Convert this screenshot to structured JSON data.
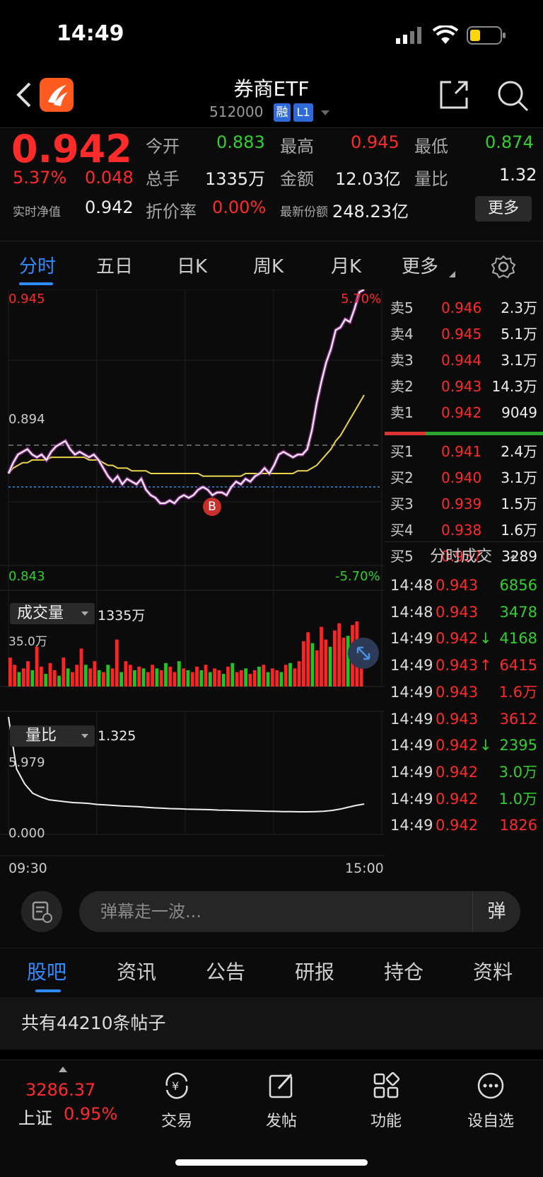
{
  "status_bar": {
    "time": "14:49"
  },
  "header": {
    "title": "券商ETF",
    "code": "512000",
    "badge_rong": "融",
    "badge_level": "L1"
  },
  "quote": {
    "price": "0.942",
    "change_pct": "5.37%",
    "change": "0.048",
    "nav_label": "实时净值",
    "nav_value": "0.942",
    "open_label": "今开",
    "open": "0.883",
    "high_label": "最高",
    "high": "0.945",
    "low_label": "最低",
    "low": "0.874",
    "volume_label": "总手",
    "volume": "1335万",
    "amount_label": "金额",
    "amount": "12.03亿",
    "ratio_label": "量比",
    "ratio": "1.32",
    "discount_label": "折价率",
    "discount": "0.00%",
    "shares_label": "最新份额",
    "shares": "248.23亿",
    "more_label": "更多"
  },
  "chart_tabs": [
    "分时",
    "五日",
    "日K",
    "周K",
    "月K",
    "更多"
  ],
  "chart_data": [
    {
      "type": "line",
      "title": "",
      "x_start": "09:30",
      "x_end": "15:00",
      "y_top_label": "0.945",
      "y_mid_label": "0.894",
      "y_bottom_label": "0.843",
      "pct_top_label": "5.70%",
      "pct_bottom_label": "-5.70%",
      "ylim": [
        0.843,
        0.945
      ],
      "buy_marker": "B",
      "series": [
        {
          "values": [
            0.877,
            0.881,
            0.884,
            0.885,
            0.886,
            0.884,
            0.883,
            0.884,
            0.882,
            0.885,
            0.887,
            0.888,
            0.889,
            0.886,
            0.884,
            0.885,
            0.884,
            0.883,
            0.884,
            0.882,
            0.879,
            0.876,
            0.874,
            0.876,
            0.873,
            0.875,
            0.874,
            0.873,
            0.875,
            0.871,
            0.869,
            0.868,
            0.866,
            0.866,
            0.867,
            0.866,
            0.868,
            0.869,
            0.868,
            0.869,
            0.871,
            0.872,
            0.871,
            0.869,
            0.87,
            0.87,
            0.869,
            0.872,
            0.874,
            0.873,
            0.875,
            0.874,
            0.876,
            0.877,
            0.879,
            0.877,
            0.88,
            0.884,
            0.885,
            0.884,
            0.883,
            0.884,
            0.884,
            0.886,
            0.893,
            0.903,
            0.911,
            0.918,
            0.923,
            0.93,
            0.931,
            0.934,
            0.933,
            0.938,
            0.944,
            0.945
          ]
        },
        {
          "values": [
            0.877,
            0.879,
            0.88,
            0.881,
            0.881,
            0.882,
            0.882,
            0.882,
            0.882,
            0.883,
            0.883,
            0.883,
            0.883,
            0.883,
            0.883,
            0.883,
            0.883,
            0.882,
            0.882,
            0.882,
            0.881,
            0.88,
            0.88,
            0.879,
            0.879,
            0.879,
            0.878,
            0.878,
            0.878,
            0.878,
            0.877,
            0.877,
            0.877,
            0.877,
            0.877,
            0.877,
            0.877,
            0.877,
            0.877,
            0.877,
            0.877,
            0.876,
            0.876,
            0.876,
            0.876,
            0.876,
            0.876,
            0.876,
            0.876,
            0.876,
            0.877,
            0.877,
            0.877,
            0.877,
            0.877,
            0.877,
            0.877,
            0.877,
            0.877,
            0.877,
            0.877,
            0.878,
            0.878,
            0.878,
            0.879,
            0.88,
            0.882,
            0.884,
            0.886,
            0.889,
            0.891,
            0.894,
            0.897,
            0.9,
            0.903,
            0.906
          ]
        }
      ]
    },
    {
      "type": "bar",
      "title": "成交量",
      "total_label": "1335万",
      "y_top_label": "35.0万",
      "values": [
        16,
        12,
        8,
        10,
        14,
        9,
        22,
        11,
        7,
        13,
        9,
        6,
        16,
        10,
        8,
        12,
        21,
        12,
        10,
        14,
        9,
        8,
        12,
        10,
        26,
        8,
        14,
        12,
        9,
        11,
        10,
        8,
        12,
        10,
        9,
        13,
        11,
        8,
        14,
        10,
        9,
        8,
        11,
        9,
        12,
        8,
        10,
        9,
        7,
        11,
        13,
        8,
        9,
        10,
        7,
        9,
        11,
        12,
        8,
        10,
        9,
        8,
        12,
        13,
        10,
        14,
        25,
        30,
        24,
        20,
        33,
        26,
        22,
        31,
        35,
        27,
        28,
        34,
        36,
        22
      ],
      "colors": [
        "r",
        "r",
        "g",
        "r",
        "r",
        "g",
        "r",
        "r",
        "g",
        "r",
        "r",
        "g",
        "r",
        "g",
        "r",
        "r",
        "r",
        "g",
        "r",
        "r",
        "g",
        "r",
        "g",
        "r",
        "r",
        "g",
        "r",
        "r",
        "g",
        "r",
        "g",
        "r",
        "r",
        "g",
        "r",
        "g",
        "r",
        "r",
        "g",
        "r",
        "g",
        "r",
        "r",
        "g",
        "r",
        "g",
        "r",
        "r",
        "g",
        "r",
        "g",
        "r",
        "r",
        "g",
        "r",
        "r",
        "g",
        "r",
        "g",
        "r",
        "r",
        "g",
        "r",
        "g",
        "r",
        "r",
        "r",
        "r",
        "g",
        "r",
        "r",
        "r",
        "g",
        "r",
        "r",
        "r",
        "g",
        "r",
        "r",
        "r"
      ]
    },
    {
      "type": "line",
      "title": "量比",
      "value_label": "1.325",
      "y_top_label": "5.979",
      "y_bottom_label": "0.000",
      "x_start": "09:30",
      "x_end": "15:00",
      "values": [
        5.979,
        3.2,
        2.4,
        1.9,
        1.7,
        1.55,
        1.5,
        1.45,
        1.4,
        1.38,
        1.35,
        1.3,
        1.28,
        1.25,
        1.22,
        1.2,
        1.18,
        1.15,
        1.12,
        1.1,
        1.08,
        1.07,
        1.05,
        1.04,
        1.03,
        1.02,
        1.0,
        0.99,
        0.98,
        0.97,
        0.96,
        0.95,
        0.94,
        0.93,
        0.92,
        0.92,
        0.91,
        0.91,
        0.92,
        0.94,
        0.98,
        1.05,
        1.15,
        1.25,
        1.325
      ]
    }
  ],
  "order_book": {
    "asks": [
      {
        "label": "卖5",
        "price": "0.946",
        "vol": "2.3万"
      },
      {
        "label": "卖4",
        "price": "0.945",
        "vol": "5.1万"
      },
      {
        "label": "卖3",
        "price": "0.944",
        "vol": "3.1万"
      },
      {
        "label": "卖2",
        "price": "0.943",
        "vol": "14.3万"
      },
      {
        "label": "卖1",
        "price": "0.942",
        "vol": "9049"
      }
    ],
    "bids": [
      {
        "label": "买1",
        "price": "0.941",
        "vol": "2.4万"
      },
      {
        "label": "买2",
        "price": "0.940",
        "vol": "3.1万"
      },
      {
        "label": "买3",
        "price": "0.939",
        "vol": "1.5万"
      },
      {
        "label": "买4",
        "price": "0.938",
        "vol": "1.6万"
      },
      {
        "label": "买5",
        "price": "0.937",
        "vol": "3289"
      }
    ]
  },
  "ticks_title": "分时成交",
  "ticks": [
    {
      "time": "14:48",
      "price": "0.943",
      "arrow": "",
      "vol": "6856",
      "c": "green"
    },
    {
      "time": "14:48",
      "price": "0.943",
      "arrow": "",
      "vol": "3478",
      "c": "green"
    },
    {
      "time": "14:49",
      "price": "0.942",
      "arrow": "↓",
      "vol": "4168",
      "c": "green"
    },
    {
      "time": "14:49",
      "price": "0.943",
      "arrow": "↑",
      "vol": "6415",
      "c": "red"
    },
    {
      "time": "14:49",
      "price": "0.943",
      "arrow": "",
      "vol": "1.6万",
      "c": "red"
    },
    {
      "time": "14:49",
      "price": "0.943",
      "arrow": "",
      "vol": "3612",
      "c": "red"
    },
    {
      "time": "14:49",
      "price": "0.942",
      "arrow": "↓",
      "vol": "2395",
      "c": "green"
    },
    {
      "time": "14:49",
      "price": "0.942",
      "arrow": "",
      "vol": "3.0万",
      "c": "green"
    },
    {
      "time": "14:49",
      "price": "0.942",
      "arrow": "",
      "vol": "1.0万",
      "c": "green"
    },
    {
      "time": "14:49",
      "price": "0.942",
      "arrow": "",
      "vol": "1826",
      "c": "red"
    }
  ],
  "danmu": {
    "placeholder": "弹幕走一波...",
    "btn": "弹"
  },
  "bottom_tabs": [
    "股吧",
    "资讯",
    "公告",
    "研报",
    "持仓",
    "资料"
  ],
  "posts_text": "共有44210条帖子",
  "nav": {
    "index_value": "3286.37",
    "index_name": "上证",
    "index_pct": "0.95%",
    "items": [
      "交易",
      "发帖",
      "功能",
      "设自选"
    ]
  },
  "colors": {
    "up": "#ff2a2a",
    "down": "#2fd02f",
    "accent": "#2f8cff",
    "avg": "#e8d44d"
  }
}
